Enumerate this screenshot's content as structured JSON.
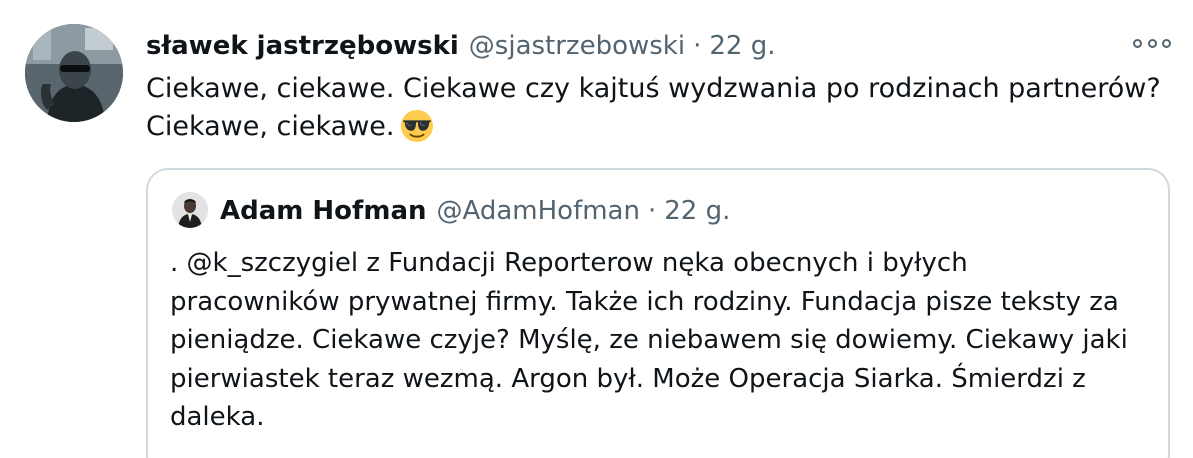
{
  "tweet": {
    "author_name": "sławek jastrzębowski",
    "author_handle": "@sjastrzebowski",
    "separator": "·",
    "time": "22 g.",
    "text_lines": [
      "Ciekawe, ciekawe. Ciekawe czy kajtuś wydzwania po rodzinach partnerów?",
      "Ciekawe, ciekawe."
    ],
    "emoji": "smiling-face-with-sunglasses",
    "more_icon": "more-horizontal-icon"
  },
  "quoted_tweet": {
    "author_name": "Adam Hofman",
    "author_handle": "@AdamHofman",
    "separator": "·",
    "time": "22 g.",
    "text_lines": [
      ". @k_szczygiel z Fundacji Reporterow nęka obecnych i byłych",
      "pracowników prywatnej firmy. Także ich rodziny. Fundacja pisze teksty za",
      "pieniądze. Ciekawe czyje? Myślę, ze niebawem się dowiemy. Ciekawy jaki",
      "pierwiastek teraz wezmą. Argon był. Może Operacja Siarka. Śmierdzi z",
      "daleka."
    ]
  },
  "colors": {
    "text_primary": "#0f1419",
    "text_secondary": "#536471",
    "border": "#cfd9de",
    "background": "#ffffff"
  }
}
